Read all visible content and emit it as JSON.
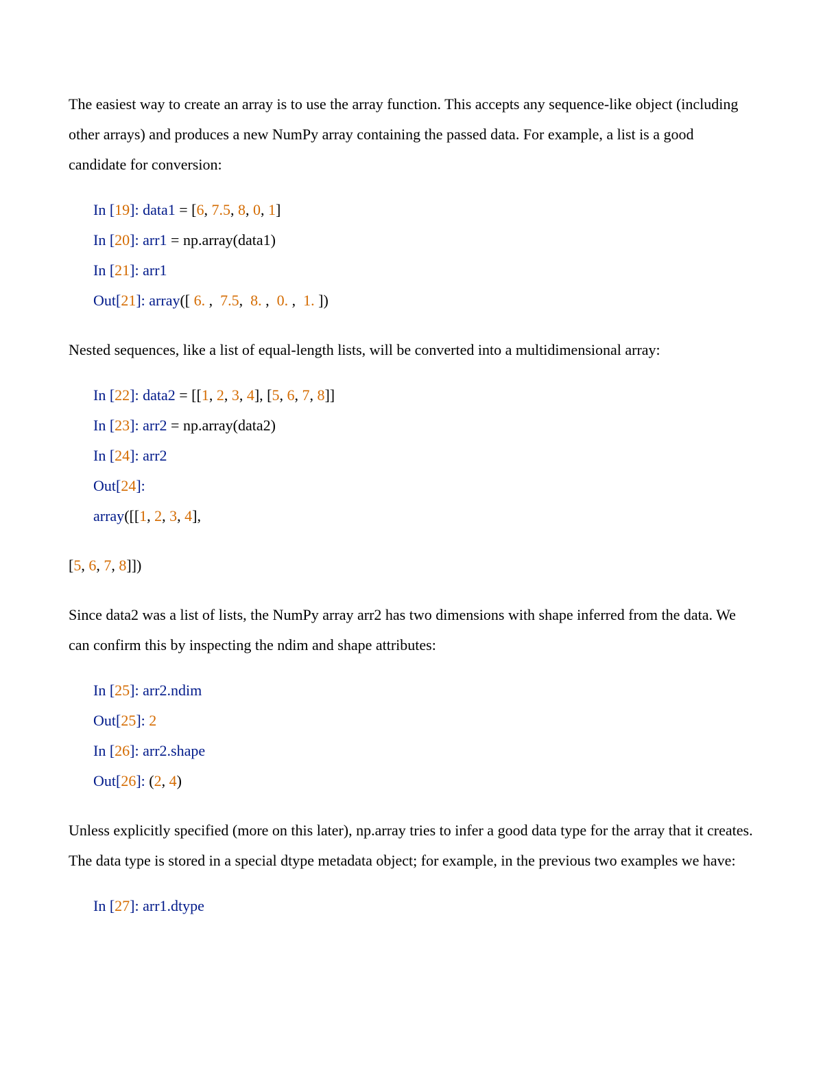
{
  "para1": "The easiest way to create an array is to use the array function. This accepts any sequence-like object (including other arrays) and produces a new NumPy array containing the passed data. For example, a list is a good candidate for conversion:",
  "block1": {
    "l1": {
      "in": "In ",
      "lb": "[",
      "n": "19",
      "rb": "]",
      "colon": ": ",
      "a": "data1 ",
      "eq": "= [",
      "v1": "6",
      "c1": ", ",
      "v2": "7.5",
      "c2": ", ",
      "v3": "8",
      "c3": ", ",
      "v4": "0",
      "c4": ", ",
      "v5": "1",
      "end": "]"
    },
    "l2": {
      "in": "In ",
      "lb": "[",
      "n": "20",
      "rb": "]",
      "colon": ": ",
      "a": "arr1 ",
      "eq": "= np.array(data1)"
    },
    "l3": {
      "in": "In ",
      "lb": "[",
      "n": "21",
      "rb": "]",
      "colon": ": ",
      "a": "arr1"
    },
    "l4": {
      "out": "Out",
      "lb": "[",
      "n": "21",
      "rb": "]",
      "colon": ": ",
      "a": "array",
      "op": "([ ",
      "v1": "6. ",
      "c1": ",  ",
      "v2": "7.5",
      "c2": ",  ",
      "v3": "8. ",
      "c3": ",  ",
      "v4": "0. ",
      "c4": ",  ",
      "v5": "1. ",
      "end": "])"
    }
  },
  "para2": "Nested sequences, like a list of equal-length lists, will be converted into a multidimensional array:",
  "block2": {
    "l1": {
      "in": "In ",
      "lb": "[",
      "n": "22",
      "rb": "]",
      "colon": ": ",
      "a": "data2 ",
      "eq": "= [[",
      "v1": "1",
      "c1": ", ",
      "v2": "2",
      "c2": ", ",
      "v3": "3",
      "c3": ", ",
      "v4": "4",
      "mid": "], [",
      "v5": "5",
      "c5": ", ",
      "v6": "6",
      "c6": ", ",
      "v7": "7",
      "c7": ", ",
      "v8": "8",
      "end": "]]"
    },
    "l2": {
      "in": "In ",
      "lb": "[",
      "n": "23",
      "rb": "]",
      "colon": ": ",
      "a": "arr2 ",
      "eq": "= np.array(data2)"
    },
    "l3": {
      "in": "In ",
      "lb": "[",
      "n": "24",
      "rb": "]",
      "colon": ": ",
      "a": "arr2"
    },
    "l4": {
      "out": "Out",
      "lb": "[",
      "n": "24",
      "rb": "]",
      "colon": ":"
    },
    "l5": {
      "a": "array",
      "op": "([[",
      "v1": "1",
      "c1": ", ",
      "v2": "2",
      "c2": ", ",
      "v3": "3",
      "c3": ", ",
      "v4": "4",
      "end": "],"
    }
  },
  "flush": {
    "lb": "[",
    "v1": "5",
    "c1": ", ",
    "v2": "6",
    "c2": ", ",
    "v3": "7",
    "c3": ", ",
    "v4": "8",
    "end": "]])"
  },
  "para3": "Since data2 was a list of lists, the NumPy array arr2 has two dimensions with shape inferred from the data. We can confirm this by inspecting the ndim and shape attributes:",
  "block3": {
    "l1": {
      "in": "In ",
      "lb": "[",
      "n": "25",
      "rb": "]",
      "colon": ": ",
      "a": "arr2.ndim"
    },
    "l2": {
      "out": "Out",
      "lb": "[",
      "n": "25",
      "rb": "]",
      "colon": ": ",
      "v": "2"
    },
    "l3": {
      "in": "In ",
      "lb": "[",
      "n": "26",
      "rb": "]",
      "colon": ": ",
      "a": "arr2.shape"
    },
    "l4": {
      "out": "Out",
      "lb": "[",
      "n": "26",
      "rb": "]",
      "colon": ": ",
      "op": "(",
      "v1": "2",
      "c1": ", ",
      "v2": "4",
      "end": ")"
    }
  },
  "para4": "Unless explicitly specified (more on this later), np.array tries to infer a good data type for the array that it creates. The data type is stored in a special dtype metadata object; for example, in the previous two examples we have:",
  "block4": {
    "l1": {
      "in": "In ",
      "lb": "[",
      "n": "27",
      "rb": "]",
      "colon": ": ",
      "a": "arr1.dtype"
    }
  }
}
